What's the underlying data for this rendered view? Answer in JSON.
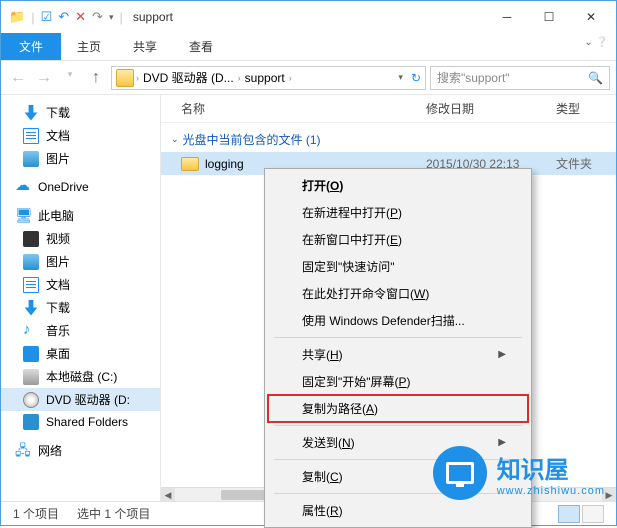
{
  "window": {
    "title": "support"
  },
  "ribbon": {
    "file": "文件",
    "tabs": [
      "主页",
      "共享",
      "查看"
    ]
  },
  "breadcrumb": {
    "items": [
      "DVD 驱动器 (D...",
      "support"
    ]
  },
  "search": {
    "placeholder": "搜索\"support\""
  },
  "nav": {
    "downloads": "下载",
    "documents": "文档",
    "pictures": "图片",
    "onedrive": "OneDrive",
    "this_pc": "此电脑",
    "videos": "视频",
    "pictures2": "图片",
    "documents2": "文档",
    "downloads2": "下载",
    "music": "音乐",
    "desktop": "桌面",
    "local_c": "本地磁盘 (C:)",
    "dvd_d": "DVD 驱动器 (D:",
    "shared": "Shared Folders",
    "network": "网络"
  },
  "columns": {
    "name": "名称",
    "date": "修改日期",
    "type": "类型"
  },
  "group": {
    "header": "光盘中当前包含的文件 (1)"
  },
  "files": [
    {
      "name": "logging",
      "date": "2015/10/30 22:13",
      "type": "文件夹"
    }
  ],
  "context_menu": {
    "open": "打开(",
    "open_key": "O",
    "open_suffix": ")",
    "open_new_process": "在新进程中打开(",
    "open_new_process_key": "P",
    "open_new_window": "在新窗口中打开(",
    "open_new_window_key": "E",
    "pin_quick": "固定到\"快速访问\"",
    "cmd_here": "在此处打开命令窗口(",
    "cmd_here_key": "W",
    "defender": "使用 Windows Defender扫描...",
    "share": "共享(",
    "share_key": "H",
    "pin_start": "固定到\"开始\"屏幕(",
    "pin_start_key": "P",
    "copy_path": "复制为路径(",
    "copy_path_key": "A",
    "send_to": "发送到(",
    "send_to_key": "N",
    "copy": "复制(",
    "copy_key": "C",
    "properties": "属性(",
    "properties_key": "R",
    "close_paren": ")"
  },
  "status": {
    "count": "1 个项目",
    "selected": "选中 1 个项目"
  },
  "watermark": {
    "title": "知识屋",
    "url": "www.zhishiwu.com"
  }
}
